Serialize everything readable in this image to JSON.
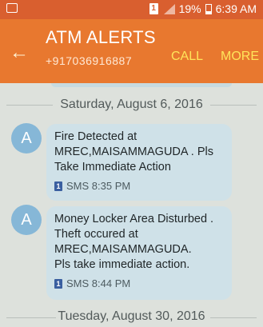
{
  "status_bar": {
    "sim": "1",
    "battery": "19%",
    "time": "6:39 AM"
  },
  "header": {
    "title": "ATM ALERTS",
    "phone": "+917036916887",
    "call": "CALL",
    "more": "MORE"
  },
  "conversation": {
    "date1": "Saturday, August 6, 2016",
    "messages": [
      {
        "avatar": "A",
        "text": "Fire Detected at\nMREC,MAISAMMAGUDA . Pls\nTake Immediate Action",
        "sim": "1",
        "meta": "SMS 8:35 PM"
      },
      {
        "avatar": "A",
        "text": "Money Locker Area Disturbed .\nTheft occured at\nMREC,MAISAMMAGUDA.\nPls take immediate action.",
        "sim": "1",
        "meta": "SMS 8:44 PM"
      }
    ],
    "date2": "Tuesday, August 30, 2016"
  },
  "colors": {
    "status_bar": "#d95f2f",
    "header": "#e8782f",
    "bubble": "#cfe1e8",
    "avatar": "#86b7d7",
    "action_text": "#ffe45a"
  }
}
